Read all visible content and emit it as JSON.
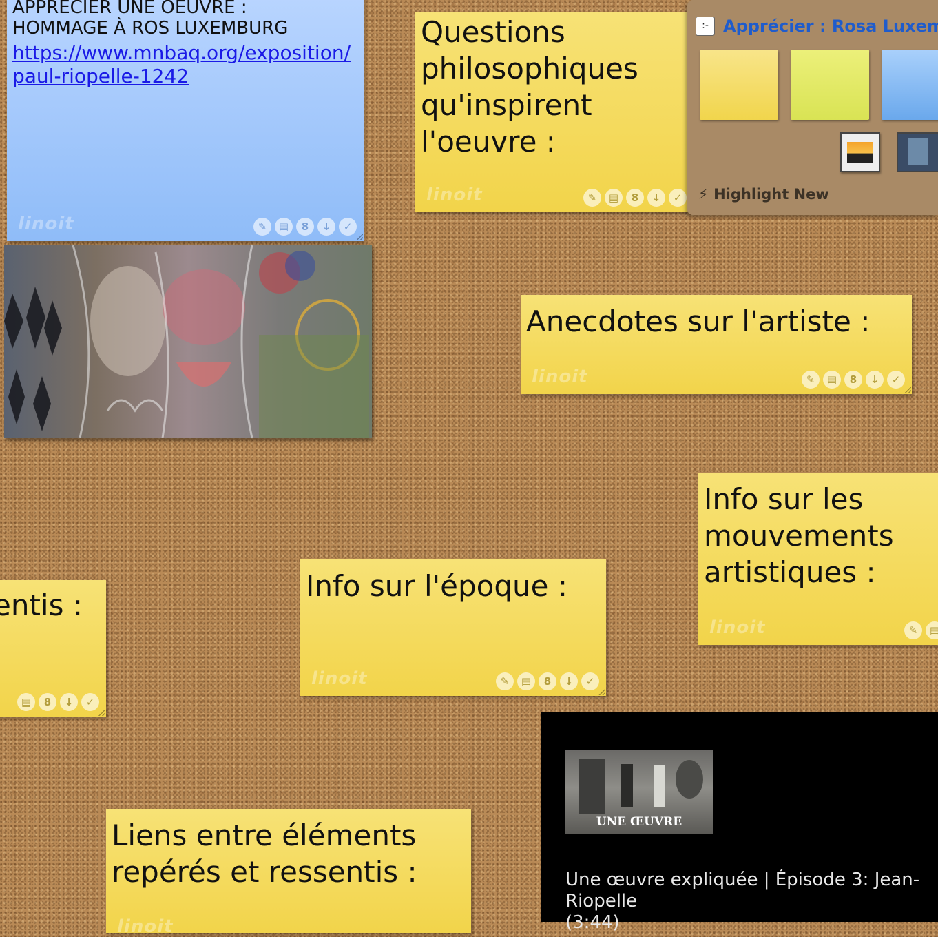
{
  "notes": {
    "hommage": {
      "heading": "APPRÉCIER UNE OEUVRE :\nHOMMAGE À ROS LUXEMBURG",
      "link": "https://www.mnbaq.org/exposition/\npaul-riopelle-1242"
    },
    "questions": {
      "text": "Questions philosophiques qu'inspirent l'oeuvre :"
    },
    "anecdotes": {
      "text": "Anecdotes sur l'artiste :"
    },
    "mouvements": {
      "text": "Info sur les mouvements artistiques :"
    },
    "epoque": {
      "text": "Info sur l'époque :"
    },
    "ressentis": {
      "text": "entis :"
    },
    "liens": {
      "text": "Liens entre éléments repérés et ressentis :"
    },
    "watermark": "linoit"
  },
  "panel": {
    "title": "Apprécier : Rosa Luxembo",
    "highlight_label": "Highlight New",
    "swatch_colors": [
      "#f6e07a",
      "#e6ec6a",
      "#7fb6ee"
    ]
  },
  "video": {
    "thumb_caption": "UNE ŒUVRE",
    "title": "Une œuvre expliquée | Épisode 3: Jean-\nRiopelle\n(3:44)"
  },
  "icons": [
    "edit-icon",
    "calendar-icon",
    "lock-icon",
    "download-icon",
    "check-icon"
  ]
}
